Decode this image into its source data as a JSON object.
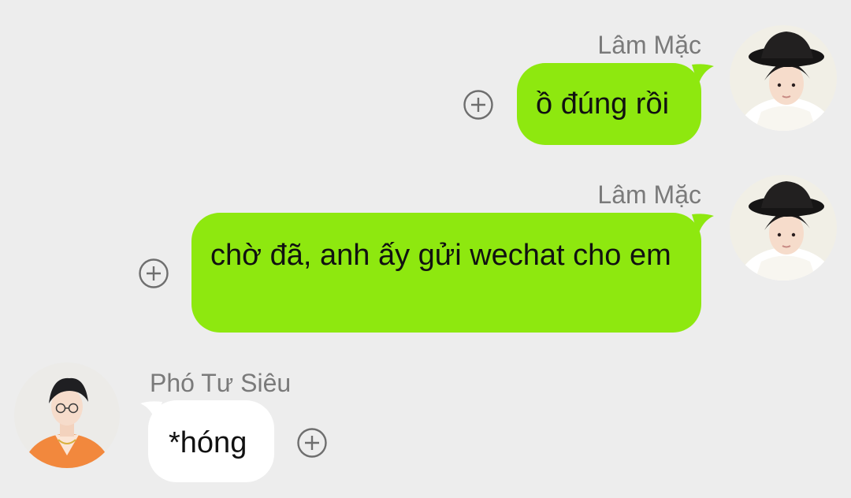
{
  "colors": {
    "background": "#ededed",
    "outgoing_bubble": "#8ee80f",
    "incoming_bubble": "#ffffff",
    "sender_name": "#7a7a7a",
    "add_icon": "#6e6e6e"
  },
  "messages": [
    {
      "direction": "outgoing",
      "sender": "Lâm Mặc",
      "text": "ồ đúng rồi",
      "action_icon": "add-circle-icon"
    },
    {
      "direction": "outgoing",
      "sender": "Lâm Mặc",
      "text": "chờ đã, anh ấy gửi wechat cho em",
      "action_icon": "add-circle-icon"
    },
    {
      "direction": "incoming",
      "sender": "Phó Tư Siêu",
      "text": "*hóng",
      "action_icon": "add-circle-icon"
    }
  ]
}
